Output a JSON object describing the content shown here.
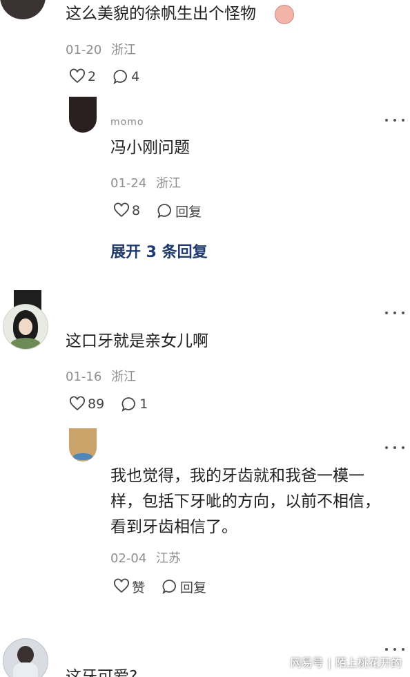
{
  "comments": [
    {
      "text": "这么美貌的徐帆生出个怪物",
      "date": "01-20",
      "location": "浙江",
      "likes": "2",
      "replies_count": "4"
    },
    {
      "username": "momo",
      "text": "冯小刚问题",
      "date": "01-24",
      "location": "浙江",
      "likes": "8",
      "reply_label": "回复",
      "expand_label": "展开 3 条回复"
    },
    {
      "text": "这口牙就是亲女儿啊",
      "date": "01-16",
      "location": "浙江",
      "likes": "89",
      "replies_count": "1"
    },
    {
      "text_line1": "我也觉得，我的牙齿就和我爸一模一",
      "text_line2": "样，包括下牙呲的方向，以前不相信，",
      "text_line3": "看到牙齿相信了。",
      "date": "02-04",
      "location": "江苏",
      "like_label": "赞",
      "reply_label": "回复"
    },
    {
      "text": "这牙可爱?"
    }
  ],
  "watermark": {
    "left": "网易号",
    "right": "陌上桃花开的"
  },
  "colors": {
    "link": "#1e3a6e",
    "meta": "#8e8e8e"
  }
}
